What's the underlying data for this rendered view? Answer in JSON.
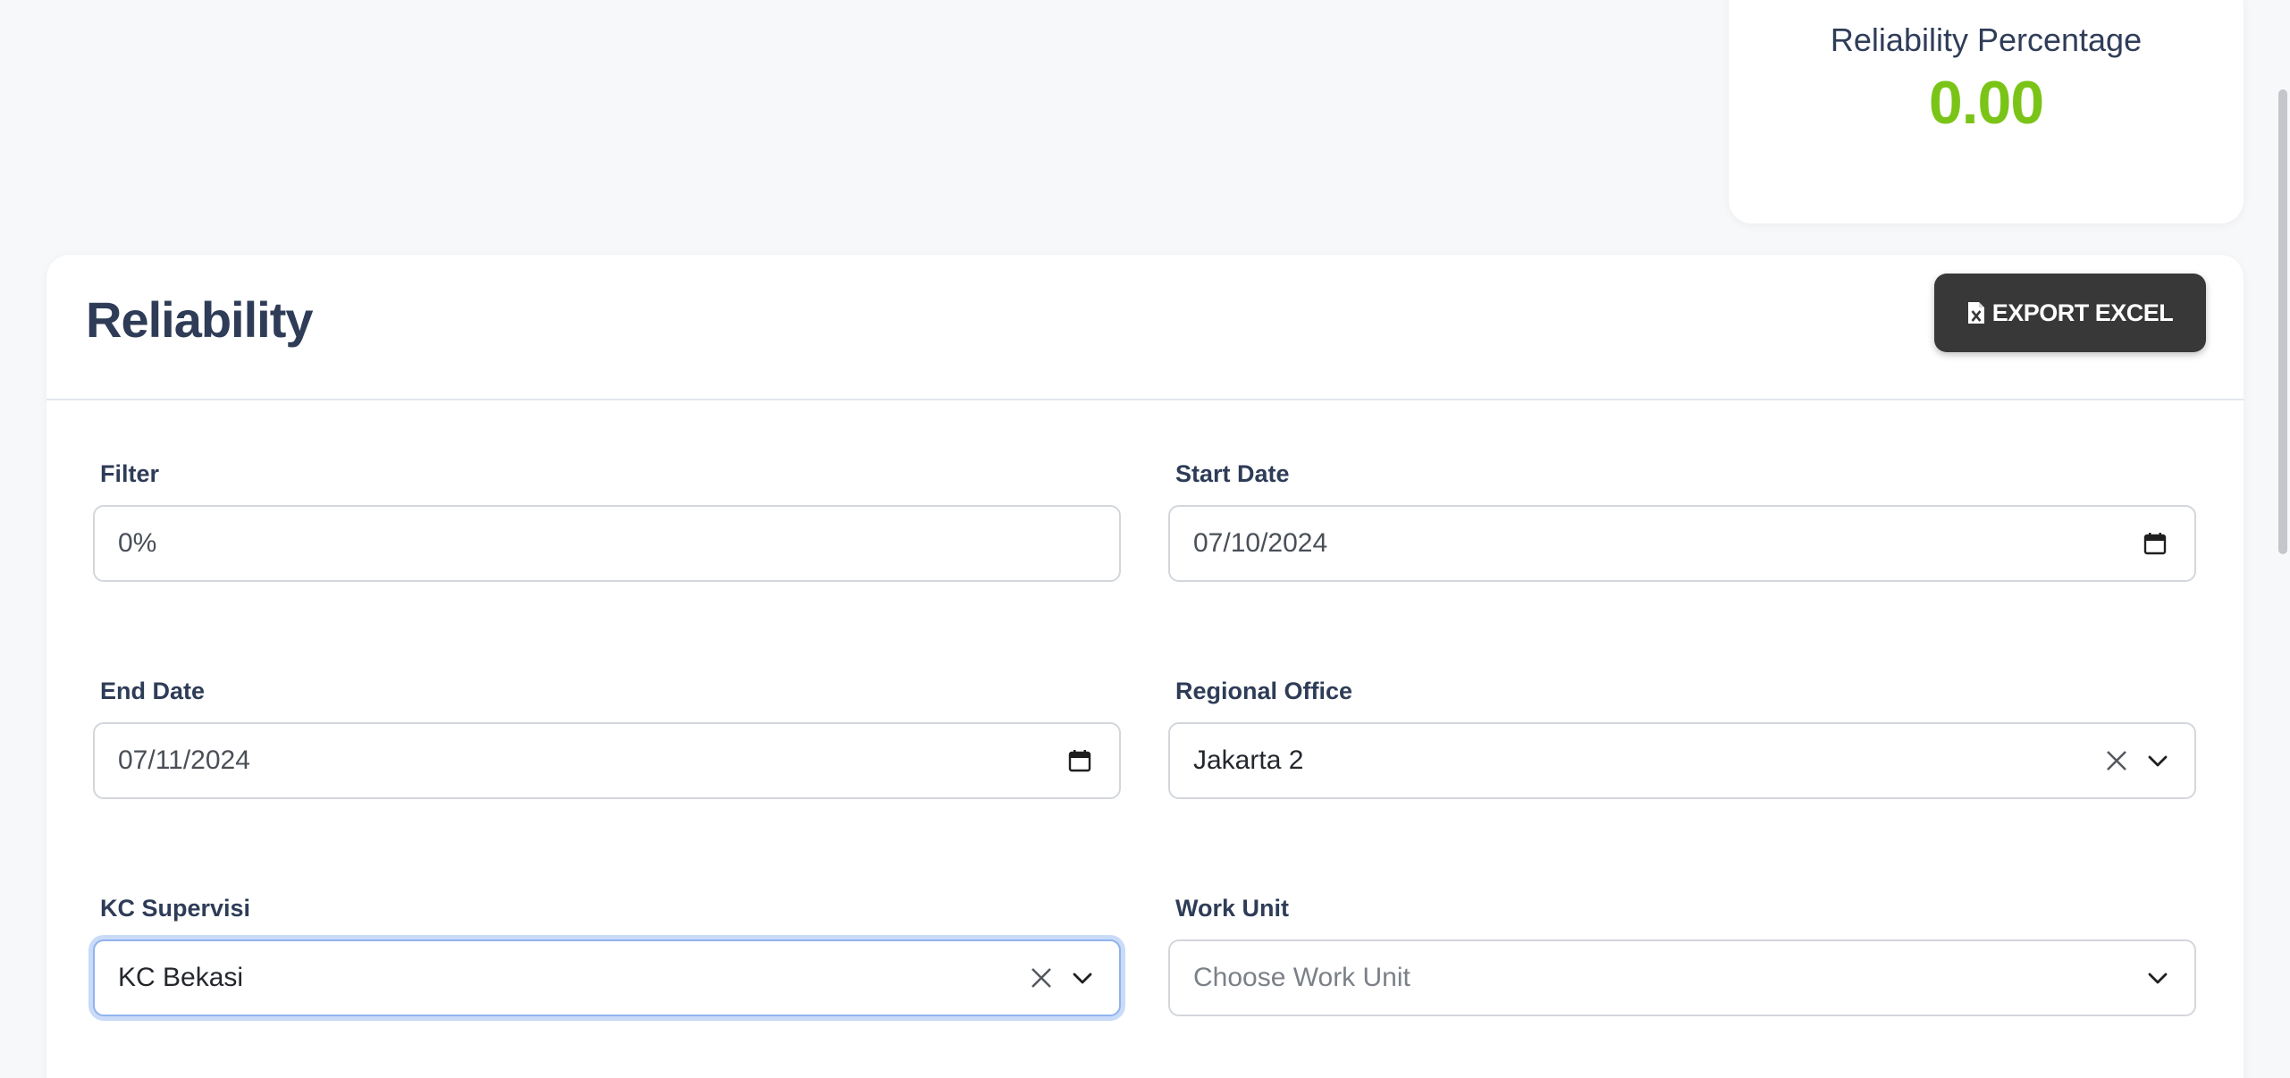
{
  "stat": {
    "title": "Reliability Percentage",
    "value": "0.00",
    "value_color": "#7ac417"
  },
  "header": {
    "title": "Reliability",
    "export_label": "EXPORT EXCEL",
    "export_icon": "file-excel-icon"
  },
  "form": {
    "filter": {
      "label": "Filter",
      "value": "0%"
    },
    "start_date": {
      "label": "Start Date",
      "value": "07/10/2024",
      "icon": "calendar-icon"
    },
    "end_date": {
      "label": "End Date",
      "value": "07/11/2024",
      "icon": "calendar-icon"
    },
    "regional_office": {
      "label": "Regional Office",
      "value": "Jakarta 2"
    },
    "kc_supervisi": {
      "label": "KC Supervisi",
      "value": "KC Bekasi"
    },
    "work_unit": {
      "label": "Work Unit",
      "placeholder": "Choose Work Unit"
    }
  }
}
